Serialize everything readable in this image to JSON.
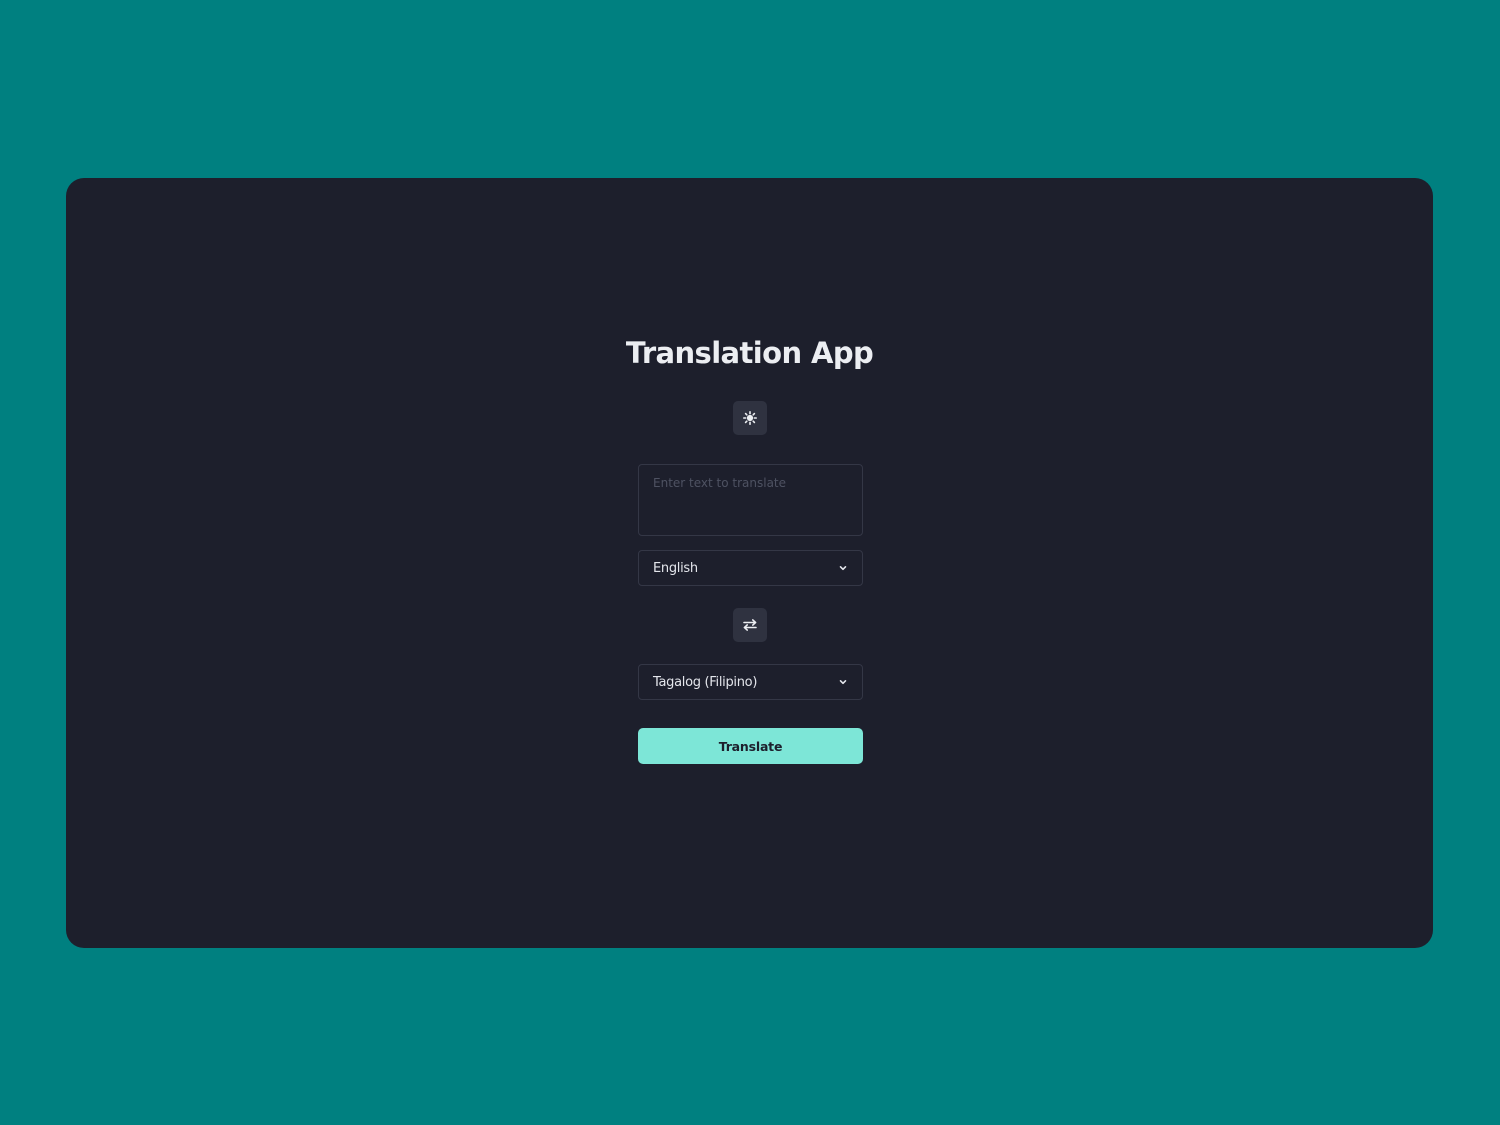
{
  "app": {
    "title": "Translation App"
  },
  "theme_toggle": {
    "icon": "sun-icon"
  },
  "input": {
    "placeholder": "Enter text to translate",
    "value": ""
  },
  "source_language": {
    "selected": "English"
  },
  "swap": {
    "icon": "swap-arrows-icon"
  },
  "target_language": {
    "selected": "Tagalog (Filipino)"
  },
  "translate_button": {
    "label": "Translate"
  },
  "colors": {
    "page_background": "#008080",
    "card_background": "#1d1f2c",
    "accent": "#7de6d7",
    "icon_button": "#2f3240",
    "field_border": "#343746"
  }
}
